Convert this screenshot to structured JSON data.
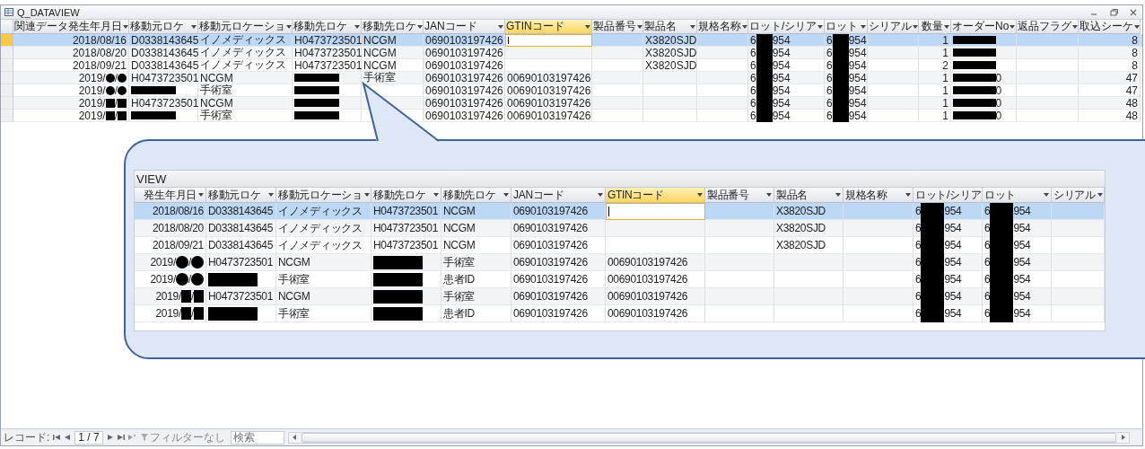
{
  "window": {
    "title": "Q_DATAVIEW"
  },
  "datasheet": {
    "columns": [
      {
        "label": "関連データ発生年月日",
        "right_aligned": true,
        "selected": false
      },
      {
        "label": "移動元ロケ",
        "selected": false
      },
      {
        "label": "移動元ロケーショ",
        "selected": false
      },
      {
        "label": "移動先ロケ",
        "selected": false
      },
      {
        "label": "移動先ロケ",
        "selected": false
      },
      {
        "label": "JANコード",
        "selected": false
      },
      {
        "label": "GTINコード",
        "selected": true
      },
      {
        "label": "製品番号",
        "selected": false
      },
      {
        "label": "製品名",
        "selected": false
      },
      {
        "label": "規格名称",
        "selected": false
      },
      {
        "label": "ロット/シリア",
        "selected": false
      },
      {
        "label": "ロット",
        "selected": false
      },
      {
        "label": "シリアル",
        "selected": false
      },
      {
        "label": "数量",
        "right_aligned": true,
        "selected": false
      },
      {
        "label": "オーダーNo",
        "selected": false
      },
      {
        "label": "返品フラグ",
        "selected": false
      },
      {
        "label": "取込シーケ",
        "right_aligned": true,
        "selected": false
      }
    ],
    "rows": [
      {
        "selected": true,
        "cells": [
          "2018/08/16",
          "D0338143645",
          "イノメディックス",
          "H0473723501",
          "NCGM",
          "0690103197426",
          null,
          null,
          "X3820SJD",
          null,
          [
            "6",
            {
              "kind": "bar"
            },
            "954"
          ],
          [
            "6",
            {
              "kind": "bar"
            },
            "954"
          ],
          null,
          "1",
          [
            {
              "kind": "block"
            }
          ],
          null,
          "8"
        ]
      },
      {
        "selected": false,
        "cells": [
          "2018/08/20",
          "D0338143645",
          "イノメディックス",
          "H0473723501",
          "NCGM",
          "0690103197426",
          null,
          null,
          "X3820SJD",
          null,
          [
            "6",
            {
              "kind": "bar"
            },
            "954"
          ],
          [
            "6",
            {
              "kind": "bar"
            },
            "954"
          ],
          null,
          "1",
          [
            {
              "kind": "block"
            }
          ],
          null,
          "8"
        ]
      },
      {
        "selected": false,
        "cells": [
          "2018/09/21",
          "D0338143645",
          "イノメディックス",
          "H0473723501",
          "NCGM",
          "0690103197426",
          null,
          null,
          "X3820SJD",
          null,
          [
            "6",
            {
              "kind": "bar"
            },
            "954"
          ],
          [
            "6",
            {
              "kind": "bar"
            },
            "954"
          ],
          null,
          "2",
          [
            {
              "kind": "block"
            }
          ],
          null,
          "8"
        ]
      },
      {
        "selected": false,
        "cells": [
          [
            "2019/",
            {
              "kind": "circle"
            },
            "/",
            {
              "kind": "circle"
            }
          ],
          "H0473723501",
          "NCGM",
          [
            {
              "kind": "block"
            }
          ],
          "手術室",
          "0690103197426",
          "00690103197426",
          null,
          null,
          null,
          [
            "6",
            {
              "kind": "bar"
            },
            "954"
          ],
          [
            "6",
            {
              "kind": "bar"
            },
            "954"
          ],
          null,
          "1",
          [
            {
              "kind": "block"
            },
            "0"
          ],
          null,
          "47"
        ]
      },
      {
        "selected": false,
        "cells": [
          [
            "2019/",
            {
              "kind": "circle"
            },
            "/",
            {
              "kind": "circle"
            }
          ],
          [
            {
              "kind": "block"
            }
          ],
          "手術室",
          [
            {
              "kind": "block"
            }
          ],
          null,
          "0690103197426",
          "00690103197426",
          null,
          null,
          null,
          [
            "6",
            {
              "kind": "bar"
            },
            "954"
          ],
          [
            "6",
            {
              "kind": "bar"
            },
            "954"
          ],
          null,
          "1",
          [
            {
              "kind": "block"
            },
            "0"
          ],
          null,
          "47"
        ]
      },
      {
        "selected": false,
        "cells": [
          [
            "2019/",
            {
              "kind": "square"
            },
            "/",
            {
              "kind": "square"
            }
          ],
          "H0473723501",
          "NCGM",
          [
            {
              "kind": "block"
            }
          ],
          null,
          "0690103197426",
          "00690103197426",
          null,
          null,
          null,
          [
            "6",
            {
              "kind": "bar"
            },
            "954"
          ],
          [
            "6",
            {
              "kind": "bar"
            },
            "954"
          ],
          null,
          "1",
          [
            {
              "kind": "block"
            },
            "0"
          ],
          null,
          "48"
        ]
      },
      {
        "selected": false,
        "cells": [
          [
            "2019/",
            {
              "kind": "square"
            },
            "/",
            {
              "kind": "square"
            }
          ],
          [
            {
              "kind": "block"
            }
          ],
          "手術室",
          [
            {
              "kind": "block"
            }
          ],
          null,
          "0690103197426",
          "00690103197426",
          null,
          null,
          null,
          [
            "6",
            {
              "kind": "bar"
            },
            "954"
          ],
          [
            "6",
            {
              "kind": "bar"
            },
            "954"
          ],
          null,
          "1",
          [
            {
              "kind": "block"
            },
            "0"
          ],
          null,
          "48"
        ]
      }
    ]
  },
  "record_nav": {
    "label": "レコード:",
    "position": "1 / 7",
    "filter": "フィルターなし",
    "search": {
      "placeholder": "検索"
    }
  },
  "callout": {
    "title": "VIEW",
    "columns": [
      {
        "label": "発生年月日",
        "right_aligned": true,
        "selected": false
      },
      {
        "label": "移動元ロケ",
        "selected": false
      },
      {
        "label": "移動元ロケーショ",
        "selected": false
      },
      {
        "label": "移動先ロケ",
        "selected": false
      },
      {
        "label": "移動先ロケ",
        "selected": false
      },
      {
        "label": "JANコード",
        "selected": false
      },
      {
        "label": "GTINコード",
        "selected": true
      },
      {
        "label": "製品番号",
        "selected": false
      },
      {
        "label": "製品名",
        "selected": false
      },
      {
        "label": "規格名称",
        "selected": false
      },
      {
        "label": "ロット/シリア",
        "selected": false
      },
      {
        "label": "ロット",
        "selected": false
      },
      {
        "label": "シリアル",
        "selected": false
      }
    ],
    "rows": [
      {
        "selected": true,
        "cells": [
          "2018/08/16",
          "D0338143645",
          "イノメディックス",
          "H0473723501",
          "NCGM",
          "0690103197426",
          null,
          null,
          "X3820SJD",
          null,
          [
            "6",
            {
              "kind": "bar"
            },
            "954"
          ],
          [
            "6",
            {
              "kind": "bar"
            },
            "954"
          ],
          null
        ]
      },
      {
        "selected": false,
        "cells": [
          "2018/08/20",
          "D0338143645",
          "イノメディックス",
          "H0473723501",
          "NCGM",
          "0690103197426",
          null,
          null,
          "X3820SJD",
          null,
          [
            "6",
            {
              "kind": "bar"
            },
            "954"
          ],
          [
            "6",
            {
              "kind": "bar"
            },
            "954"
          ],
          null
        ]
      },
      {
        "selected": false,
        "cells": [
          "2018/09/21",
          "D0338143645",
          "イノメディックス",
          "H0473723501",
          "NCGM",
          "0690103197426",
          null,
          null,
          "X3820SJD",
          null,
          [
            "6",
            {
              "kind": "bar"
            },
            "954"
          ],
          [
            "6",
            {
              "kind": "bar"
            },
            "954"
          ],
          null
        ]
      },
      {
        "selected": false,
        "cells": [
          [
            "2019/",
            {
              "kind": "circle"
            },
            "/",
            {
              "kind": "circle"
            }
          ],
          "H0473723501",
          "NCGM",
          [
            {
              "kind": "block"
            }
          ],
          "手術室",
          "0690103197426",
          "00690103197426",
          null,
          null,
          null,
          [
            "6",
            {
              "kind": "bar"
            },
            "954"
          ],
          [
            "6",
            {
              "kind": "bar"
            },
            "954"
          ],
          null
        ]
      },
      {
        "selected": false,
        "cells": [
          [
            "2019/",
            {
              "kind": "circle"
            },
            "/",
            {
              "kind": "circle"
            }
          ],
          [
            {
              "kind": "block"
            }
          ],
          "手術室",
          [
            {
              "kind": "block"
            }
          ],
          "患者ID",
          "0690103197426",
          "00690103197426",
          null,
          null,
          null,
          [
            "6",
            {
              "kind": "bar"
            },
            "954"
          ],
          [
            "6",
            {
              "kind": "bar"
            },
            "954"
          ],
          null
        ]
      },
      {
        "selected": false,
        "cells": [
          [
            "2019/",
            {
              "kind": "square"
            },
            "/",
            {
              "kind": "square"
            }
          ],
          "H0473723501",
          "NCGM",
          [
            {
              "kind": "block"
            }
          ],
          "手術室",
          "0690103197426",
          "00690103197426",
          null,
          null,
          null,
          [
            "6",
            {
              "kind": "bar"
            },
            "954"
          ],
          [
            "6",
            {
              "kind": "bar"
            },
            "954"
          ],
          null
        ]
      },
      {
        "selected": false,
        "cells": [
          [
            "2019/",
            {
              "kind": "square"
            },
            "/",
            {
              "kind": "square"
            }
          ],
          [
            {
              "kind": "block"
            }
          ],
          "手術室",
          [
            {
              "kind": "block"
            }
          ],
          "患者ID",
          "0690103197426",
          "00690103197426",
          null,
          null,
          null,
          [
            "6",
            {
              "kind": "bar"
            },
            "954"
          ],
          [
            "6",
            {
              "kind": "bar"
            },
            "954"
          ],
          null
        ]
      }
    ]
  }
}
